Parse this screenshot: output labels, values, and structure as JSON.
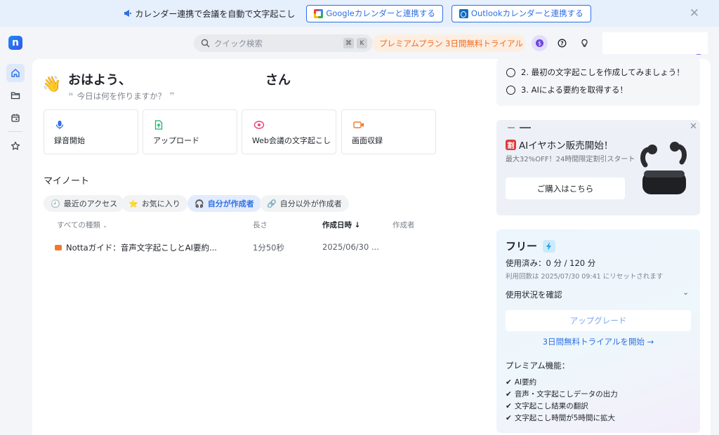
{
  "banner": {
    "text": "カレンダー連携で会議を自動で文字起こし",
    "google_btn": "Googleカレンダーと連携する",
    "outlook_btn": "Outlookカレンダーと連携する"
  },
  "logo": {
    "letter": "n"
  },
  "search": {
    "placeholder": "クイック検索",
    "shortcut_cmd": "⌘",
    "shortcut_key": "K"
  },
  "trial_pill": "プレミアムプラン 3日間無料トライアル",
  "greeting": {
    "hello": "おはよう、",
    "suffix": "さん",
    "question": "今日は何を作りますか？"
  },
  "actions": [
    {
      "label": "録音開始"
    },
    {
      "label": "アップロード"
    },
    {
      "label": "Web会議の文字起こし"
    },
    {
      "label": "画面収録"
    }
  ],
  "notes": {
    "title": "マイノート",
    "filters": [
      "最近のアクセス",
      "お気に入り",
      "自分が作成者",
      "自分以外が作成者"
    ],
    "headers": {
      "type": "すべての種類",
      "length": "長さ",
      "created": "作成日時",
      "creator": "作成者"
    },
    "rows": [
      {
        "title": "Nottaガイド：音声文字起こしとAI要約...",
        "length": "1分50秒",
        "created": "2025/06/30 ..."
      }
    ]
  },
  "todo": {
    "items": [
      "2. 最初の文字起こしを作成してみましょう！",
      "3. AIによる要約を取得する！"
    ]
  },
  "promo": {
    "badge": "割",
    "title": "AIイヤホン販売開始！",
    "subtitle": "最大32%OFF！24時間限定割引スタート",
    "button": "ご購入はこちら"
  },
  "plan": {
    "name": "フリー",
    "used": "使用済み：0 分 / 120 分",
    "reset": "利用回数は 2025/07/30 09:41 にリセットされます",
    "check": "使用状況を確認",
    "upgrade": "アップグレード",
    "trial_link": "3日間無料トライアルを開始 →",
    "features_title": "プレミアム機能：",
    "features": [
      "AI要約",
      "音声・文字起こしデータの出力",
      "文字起こし結果の翻訳",
      "文字起こし時間が5時間に拡大"
    ]
  },
  "colors": {
    "accent": "#2f6fe4",
    "trial_orange": "#ef6b1f",
    "banner_bg": "#e6effc"
  }
}
